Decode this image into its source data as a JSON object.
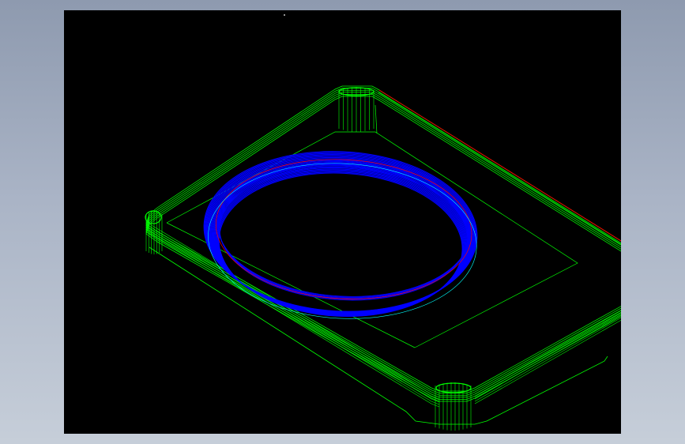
{
  "app": {
    "background_gradient_top": "#8e9aaf",
    "background_gradient_bottom": "#c6ced9"
  },
  "viewport": {
    "background_color": "#000000",
    "view_mode": "wireframe",
    "projection": "isometric"
  },
  "model": {
    "part": "rectangular-plate-with-rounded-corners",
    "feature": "circular-ring-groove",
    "colors": {
      "plate_edges": "#00ff00",
      "ring_edges": "#0000ff",
      "highlight_edges": "#ff0000",
      "secondary_edges": "#00ffff"
    }
  }
}
